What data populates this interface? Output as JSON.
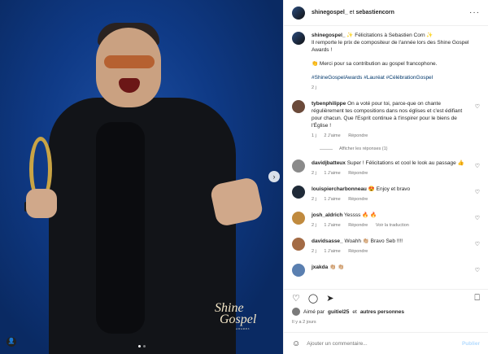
{
  "photo": {
    "watermark": {
      "line1": "Shine",
      "line2": "Gospel",
      "line3": "AWARDS"
    },
    "next_button": "›",
    "tag_user": "👤",
    "dot_count": 2
  },
  "header": {
    "user1": "shinegospel_",
    "connector": " et ",
    "user2": "sebastiencorn",
    "more": "···"
  },
  "caption": {
    "username": "shinegospel_",
    "line1": "✨ Félicitations à Sebastien Corn ✨",
    "line2": "Il remporte le prix de compositeur de l'année lors des Shine Gospel Awards !",
    "line3": "👏 Merci pour sa contribution au gospel francophone.",
    "hashtags": "#ShineGospelAwards #Lauréat #CélébrationGospel",
    "time": "2 j"
  },
  "comments": [
    {
      "username": "tybenphilippe",
      "text": "On a voté pour toi, parce-que on chante régulièrement tes compositions dans nos églises et c'est édifiant pour chacun. Que l'Esprit continue à t'inspirer pour le biens de l'Église !",
      "time": "1 j",
      "likes": "2 J'aime",
      "reply": "Répondre",
      "avatar_color": "#6b4a3a"
    },
    {
      "username": "davidjbatteux",
      "text": "Super ! Félicitations et cool le look au passage 👍",
      "time": "2 j",
      "likes": "1 J'aime",
      "reply": "Répondre",
      "avatar_color": "#8a8a8a"
    },
    {
      "username": "louispiercharbonneau",
      "text": "😍 Enjoy et bravo",
      "time": "2 j",
      "likes": "1 J'aime",
      "reply": "Répondre",
      "avatar_color": "#1f2a38"
    },
    {
      "username": "josh_aldrich",
      "text": "Yessss 🔥 🔥",
      "time": "2 j",
      "likes": "1 J'aime",
      "reply": "Répondre",
      "translate": "Voir la traduction",
      "avatar_color": "#c08a3e"
    },
    {
      "username": "davidsasse_",
      "text": "Woahh 👏🏼 Bravo Seb !!!!",
      "time": "2 j",
      "likes": "1 J'aime",
      "reply": "Répondre",
      "avatar_color": "#a36b45"
    },
    {
      "username": "jxakda",
      "text": "👏🏼 👏🏼",
      "avatar_color": "#5a7fb0"
    }
  ],
  "replies_link": "Afficher les réponses (1)",
  "likes_summary": {
    "prefix": "Aimé par ",
    "user": "guitiel25",
    "middle": " et ",
    "others": "autres personnes"
  },
  "date": "Il y a 2 jours",
  "add_comment": {
    "placeholder": "Ajouter un commentaire...",
    "post": "Publier",
    "emoji": "☺"
  },
  "icons": {
    "like": "♡",
    "comment": "◯",
    "share": "➤",
    "bookmark": "⎕",
    "heart_small": "♡"
  }
}
